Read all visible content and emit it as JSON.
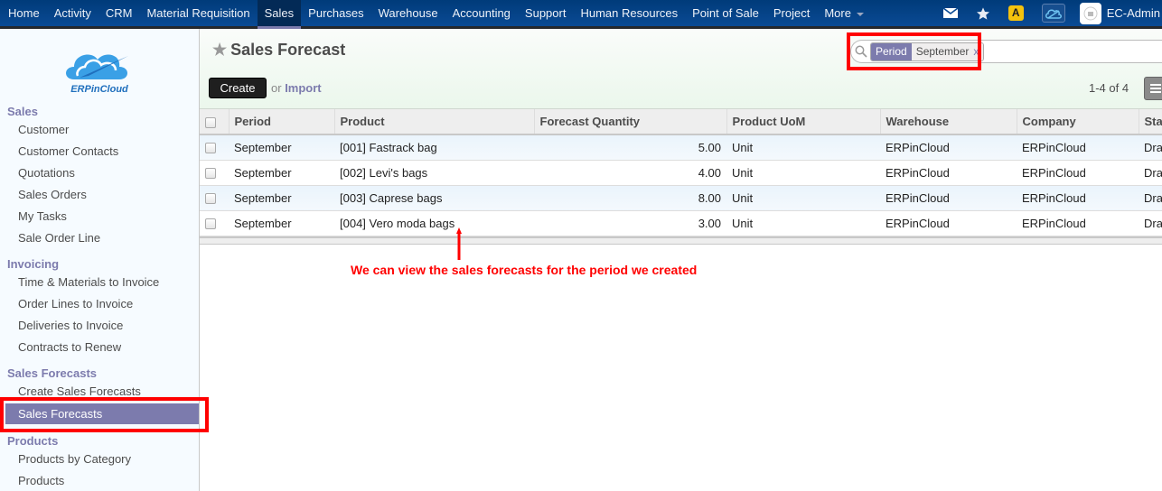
{
  "topbar": {
    "menu": [
      {
        "label": "Home",
        "active": false
      },
      {
        "label": "Activity",
        "active": false
      },
      {
        "label": "CRM",
        "active": false
      },
      {
        "label": "Material Requisition",
        "active": false
      },
      {
        "label": "Sales",
        "active": true
      },
      {
        "label": "Purchases",
        "active": false
      },
      {
        "label": "Warehouse",
        "active": false
      },
      {
        "label": "Accounting",
        "active": false
      },
      {
        "label": "Support",
        "active": false
      },
      {
        "label": "Human Resources",
        "active": false
      },
      {
        "label": "Point of Sale",
        "active": false
      },
      {
        "label": "Project",
        "active": false
      },
      {
        "label": "More",
        "active": false
      }
    ],
    "icons": [
      "mail-icon",
      "star-icon",
      "warning-icon",
      "cloud-app-icon"
    ],
    "warning_glyph": "A",
    "user_name": "EC-Admin"
  },
  "sidebar": {
    "logo_text": "ERPinCloud",
    "sections": [
      {
        "title": "Sales",
        "items": [
          "Customer",
          "Customer Contacts",
          "Quotations",
          "Sales Orders",
          "My Tasks",
          "Sale Order Line"
        ]
      },
      {
        "title": "Invoicing",
        "items": [
          "Time & Materials to Invoice",
          "Order Lines to Invoice",
          "Deliveries to Invoice",
          "Contracts to Renew"
        ]
      },
      {
        "title": "Sales Forecasts",
        "items": [
          "Create Sales Forecasts",
          "Sales Forecasts"
        ]
      },
      {
        "title": "Products",
        "items": [
          "Products by Category",
          "Products"
        ]
      }
    ],
    "active_item": "Sales Forecasts"
  },
  "header": {
    "title": "Sales Forecast",
    "create_label": "Create",
    "or_label": "or",
    "import_label": "Import",
    "search": {
      "facet_category": "Period",
      "facet_value": "September",
      "facet_remove": "x"
    },
    "pager": "1-4 of 4"
  },
  "table": {
    "columns": [
      "Period",
      "Product",
      "Forecast Quantity",
      "Product UoM",
      "Warehouse",
      "Company",
      "Status"
    ],
    "rows": [
      {
        "period": "September",
        "product": "[001] Fastrack bag",
        "qty": "5.00",
        "uom": "Unit",
        "warehouse": "ERPinCloud",
        "company": "ERPinCloud",
        "status": "Draft"
      },
      {
        "period": "September",
        "product": "[002] Levi's bags",
        "qty": "4.00",
        "uom": "Unit",
        "warehouse": "ERPinCloud",
        "company": "ERPinCloud",
        "status": "Draft"
      },
      {
        "period": "September",
        "product": "[003] Caprese bags",
        "qty": "8.00",
        "uom": "Unit",
        "warehouse": "ERPinCloud",
        "company": "ERPinCloud",
        "status": "Draft"
      },
      {
        "period": "September",
        "product": "[004] Vero moda bags",
        "qty": "3.00",
        "uom": "Unit",
        "warehouse": "ERPinCloud",
        "company": "ERPinCloud",
        "status": "Draft"
      }
    ]
  },
  "annotation": {
    "text": "We can view the sales forecasts for the period we created",
    "color": "#ff0000"
  },
  "colors": {
    "nav_bg": "#0a4a94",
    "accent": "#7c7bad",
    "highlight_box": "#ff0000"
  }
}
